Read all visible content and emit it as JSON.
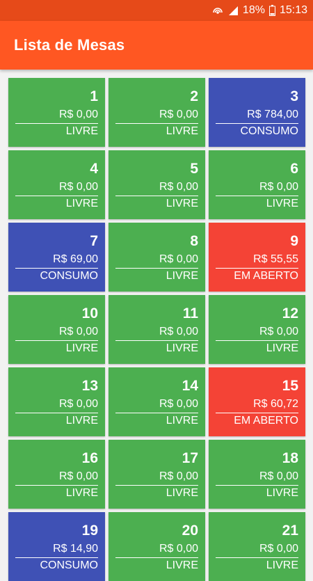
{
  "status_bar": {
    "battery": "18%",
    "time": "15:13"
  },
  "app_bar": {
    "title": "Lista de Mesas"
  },
  "colors": {
    "LIVRE": "#4caf50",
    "CONSUMO": "#3f51b5",
    "EM ABERTO": "#f44336"
  },
  "tables": [
    {
      "number": "1",
      "value": "R$ 0,00",
      "status": "LIVRE"
    },
    {
      "number": "2",
      "value": "R$ 0,00",
      "status": "LIVRE"
    },
    {
      "number": "3",
      "value": "R$ 784,00",
      "status": "CONSUMO"
    },
    {
      "number": "4",
      "value": "R$ 0,00",
      "status": "LIVRE"
    },
    {
      "number": "5",
      "value": "R$ 0,00",
      "status": "LIVRE"
    },
    {
      "number": "6",
      "value": "R$ 0,00",
      "status": "LIVRE"
    },
    {
      "number": "7",
      "value": "R$ 69,00",
      "status": "CONSUMO"
    },
    {
      "number": "8",
      "value": "R$ 0,00",
      "status": "LIVRE"
    },
    {
      "number": "9",
      "value": "R$ 55,55",
      "status": "EM ABERTO"
    },
    {
      "number": "10",
      "value": "R$ 0,00",
      "status": "LIVRE"
    },
    {
      "number": "11",
      "value": "R$ 0,00",
      "status": "LIVRE"
    },
    {
      "number": "12",
      "value": "R$ 0,00",
      "status": "LIVRE"
    },
    {
      "number": "13",
      "value": "R$ 0,00",
      "status": "LIVRE"
    },
    {
      "number": "14",
      "value": "R$ 0,00",
      "status": "LIVRE"
    },
    {
      "number": "15",
      "value": "R$ 60,72",
      "status": "EM ABERTO"
    },
    {
      "number": "16",
      "value": "R$ 0,00",
      "status": "LIVRE"
    },
    {
      "number": "17",
      "value": "R$ 0,00",
      "status": "LIVRE"
    },
    {
      "number": "18",
      "value": "R$ 0,00",
      "status": "LIVRE"
    },
    {
      "number": "19",
      "value": "R$ 14,90",
      "status": "CONSUMO"
    },
    {
      "number": "20",
      "value": "R$ 0,00",
      "status": "LIVRE"
    },
    {
      "number": "21",
      "value": "R$ 0,00",
      "status": "LIVRE"
    }
  ]
}
